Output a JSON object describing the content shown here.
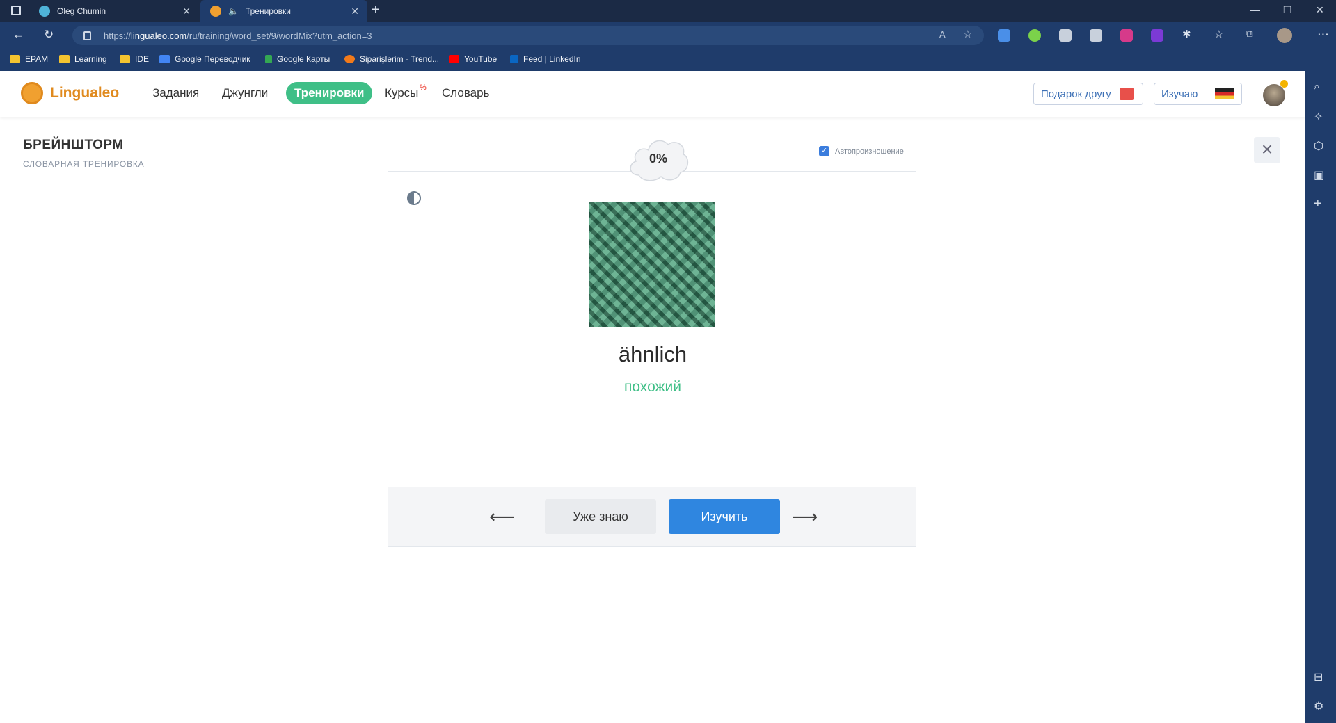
{
  "browser": {
    "tabs": [
      {
        "label": "Oleg Chumin"
      },
      {
        "label": "Тренировки"
      }
    ],
    "url_prefix": "https://",
    "url_host": "lingualeo.com",
    "url_path": "/ru/training/word_set/9/wordMix?utm_action=3",
    "bookmarks": [
      {
        "label": "EPAM",
        "color": "#f4c430"
      },
      {
        "label": "Learning",
        "color": "#f4c430"
      },
      {
        "label": "IDE",
        "color": "#f4c430"
      },
      {
        "label": "Google Переводчик",
        "color": "#4285f4"
      },
      {
        "label": "Google Карты",
        "color": "#34a853"
      },
      {
        "label": "Siparişlerim - Trend...",
        "color": "#f27a1a"
      },
      {
        "label": "YouTube",
        "color": "#ff0000"
      },
      {
        "label": "Feed | LinkedIn",
        "color": "#0a66c2"
      }
    ]
  },
  "site": {
    "brand": "Lingualeo",
    "menu": [
      "Задания",
      "Джунгли",
      "Тренировки",
      "Курсы",
      "Словарь"
    ],
    "courses_badge": "%",
    "gift_button": "Подарок другу",
    "learning_button": "Изучаю"
  },
  "training": {
    "title": "БРЕЙНШТОРМ",
    "subtitle": "СЛОВАРНАЯ ТРЕНИРОВКА",
    "progress": "0%",
    "autoplay_label": "Автопроизношение",
    "autoplay_checked": true,
    "word": "ähnlich",
    "translation": "похожий",
    "know_button": "Уже знаю",
    "learn_button": "Изучить",
    "accent_color": "#3fbf87",
    "primary_color": "#2f86e0"
  }
}
